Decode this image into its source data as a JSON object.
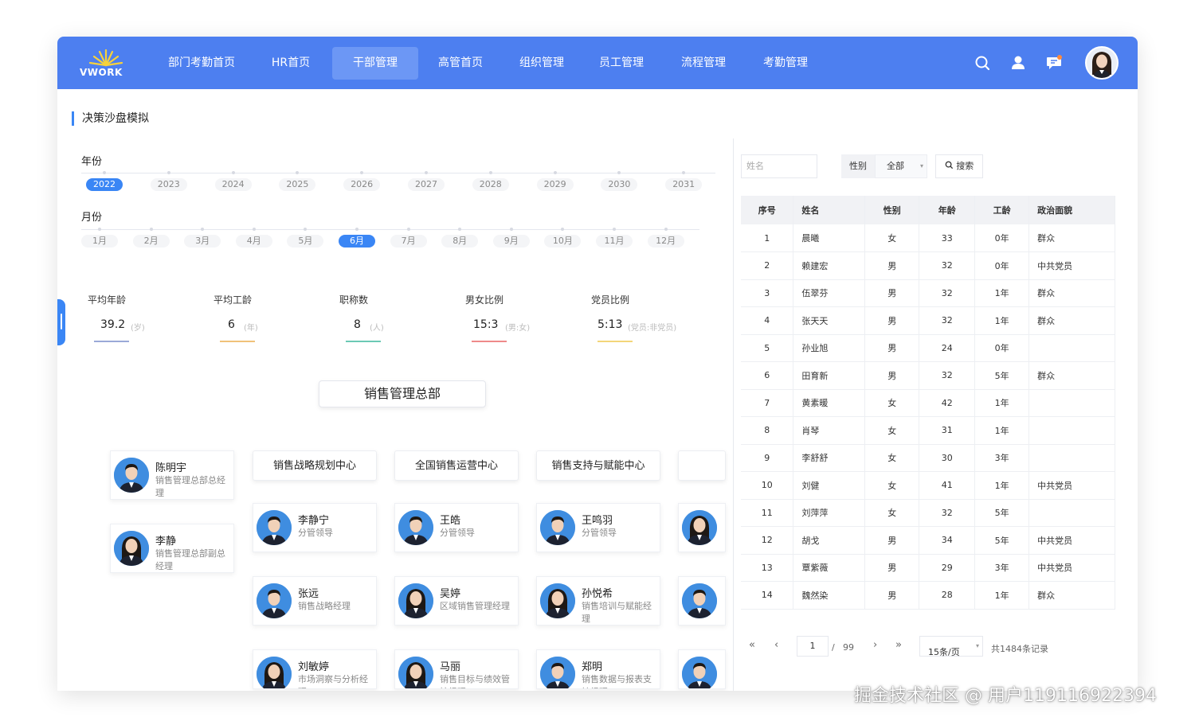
{
  "app": {
    "logo_text": "VWORK"
  },
  "nav": {
    "items": [
      {
        "label": "部门考勤首页"
      },
      {
        "label": "HR首页"
      },
      {
        "label": "干部管理"
      },
      {
        "label": "高管首页"
      },
      {
        "label": "组织管理"
      },
      {
        "label": "员工管理"
      },
      {
        "label": "流程管理"
      },
      {
        "label": "考勤管理"
      }
    ],
    "active_index": 2
  },
  "page": {
    "title": "决策沙盘模拟"
  },
  "filters": {
    "year_label": "年份",
    "years": [
      "2022",
      "2023",
      "2024",
      "2025",
      "2026",
      "2027",
      "2028",
      "2029",
      "2030",
      "2031"
    ],
    "selected_year": "2022",
    "month_label": "月份",
    "months": [
      "1月",
      "2月",
      "3月",
      "4月",
      "5月",
      "6月",
      "7月",
      "8月",
      "9月",
      "10月",
      "11月",
      "12月"
    ],
    "selected_month": "6月"
  },
  "stats": [
    {
      "label": "平均年龄",
      "value": "39.2",
      "unit": "(岁)",
      "color": "#9aa9d8"
    },
    {
      "label": "平均工龄",
      "value": "6",
      "unit": "(年)",
      "color": "#f0c27a"
    },
    {
      "label": "职称数",
      "value": "8",
      "unit": "(人)",
      "color": "#6cc9b5"
    },
    {
      "label": "男女比例",
      "value": "15:3",
      "unit": "(男:女)",
      "color": "#ef8a8a"
    },
    {
      "label": "党员比例",
      "value": "5:13",
      "unit": "(党员:非党员)",
      "color": "#f3d67a"
    }
  ],
  "org": {
    "root": "销售管理总部",
    "leaders": [
      {
        "name": "陈明宇",
        "role": "销售管理总部总经理",
        "gender": "m"
      },
      {
        "name": "李静",
        "role": "销售管理总部副总经理",
        "gender": "f"
      }
    ],
    "departments": [
      {
        "name": "销售战略规划中心",
        "members": [
          {
            "name": "李静宁",
            "role": "分管领导",
            "gender": "m"
          },
          {
            "name": "张远",
            "role": "销售战略经理",
            "gender": "m"
          },
          {
            "name": "刘敏婷",
            "role": "市场洞察与分析经理",
            "gender": "f"
          }
        ]
      },
      {
        "name": "全国销售运营中心",
        "members": [
          {
            "name": "王皓",
            "role": "分管领导",
            "gender": "m"
          },
          {
            "name": "吴婷",
            "role": "区域销售管理经理",
            "gender": "f"
          },
          {
            "name": "马丽",
            "role": "销售目标与绩效管控经理",
            "gender": "f"
          }
        ]
      },
      {
        "name": "销售支持与赋能中心",
        "members": [
          {
            "name": "王鸣羽",
            "role": "分管领导",
            "gender": "m"
          },
          {
            "name": "孙悦希",
            "role": "销售培训与赋能经理",
            "gender": "f"
          },
          {
            "name": "郑明",
            "role": "销售数据与报表支持经理",
            "gender": "m"
          }
        ]
      }
    ],
    "partial_column": [
      "f",
      "m",
      "m"
    ]
  },
  "search": {
    "name_placeholder": "姓名",
    "gender_label": "性别",
    "gender_value": "全部",
    "search_button": "搜索"
  },
  "table": {
    "headers": [
      "序号",
      "姓名",
      "性别",
      "年龄",
      "工龄",
      "政治面貌"
    ],
    "rows": [
      [
        "1",
        "晨曦",
        "女",
        "33",
        "0年",
        "群众"
      ],
      [
        "2",
        "赖建宏",
        "男",
        "32",
        "0年",
        "中共党员"
      ],
      [
        "3",
        "伍翠芬",
        "男",
        "32",
        "1年",
        "群众"
      ],
      [
        "4",
        "张天天",
        "男",
        "32",
        "1年",
        "群众"
      ],
      [
        "5",
        "孙业旭",
        "男",
        "24",
        "0年",
        ""
      ],
      [
        "6",
        "田育新",
        "男",
        "32",
        "5年",
        "群众"
      ],
      [
        "7",
        "黄素暖",
        "女",
        "42",
        "1年",
        ""
      ],
      [
        "8",
        "肖琴",
        "女",
        "31",
        "1年",
        ""
      ],
      [
        "9",
        "李舒舒",
        "女",
        "30",
        "3年",
        ""
      ],
      [
        "10",
        "刘健",
        "女",
        "41",
        "1年",
        "中共党员"
      ],
      [
        "11",
        "刘萍萍",
        "女",
        "32",
        "5年",
        ""
      ],
      [
        "12",
        "胡戈",
        "男",
        "34",
        "5年",
        "中共党员"
      ],
      [
        "13",
        "覃紫薇",
        "男",
        "29",
        "3年",
        "中共党员"
      ],
      [
        "14",
        "魏然染",
        "男",
        "28",
        "1年",
        "群众"
      ]
    ]
  },
  "pagination": {
    "current_page": "1",
    "separator": "/",
    "total_pages": "99",
    "page_size": "15条/页",
    "total_records": "共1484条记录"
  },
  "watermark": "掘金技术社区 @ 用户119116922394"
}
